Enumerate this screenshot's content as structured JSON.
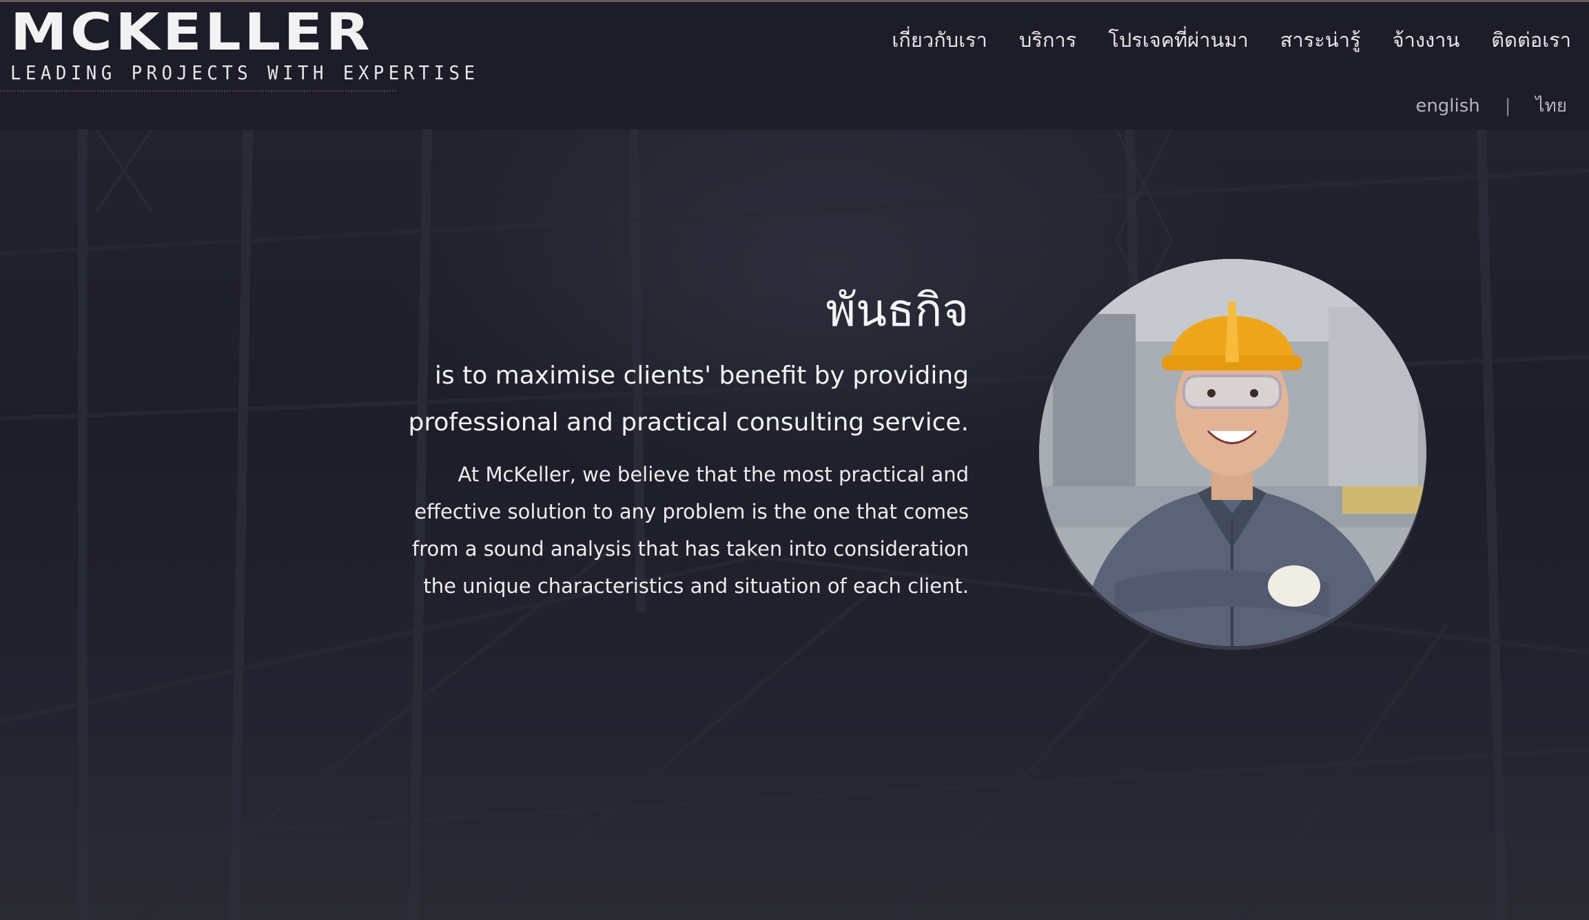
{
  "header": {
    "logo": {
      "name": "MCKELLER",
      "tagline": "LEADING PROJECTS WITH EXPERTISE"
    },
    "nav": [
      {
        "label": "เกี่ยวกับเรา"
      },
      {
        "label": "บริการ"
      },
      {
        "label": "โปรเจคที่ผ่านมา"
      },
      {
        "label": "สาระน่ารู้"
      },
      {
        "label": "จ้างงาน"
      },
      {
        "label": "ติดต่อเรา"
      }
    ],
    "languages": {
      "english": "english",
      "separator": "|",
      "thai": "ไทย"
    }
  },
  "mission": {
    "title": "พันธกิจ",
    "lead": "is to maximise clients' benefit by providing professional and practical consulting service.",
    "body": "At McKeller, we believe that the most practical and effective solution to any problem is the one that comes from a sound analysis that has taken into consideration the unique characteristics and situation of each client."
  },
  "colors": {
    "background": "#1c1d29",
    "text": "#f4f4f4",
    "accent_line": "#6b3b3f"
  },
  "photo": {
    "icon": "engineer-portrait-photo"
  }
}
